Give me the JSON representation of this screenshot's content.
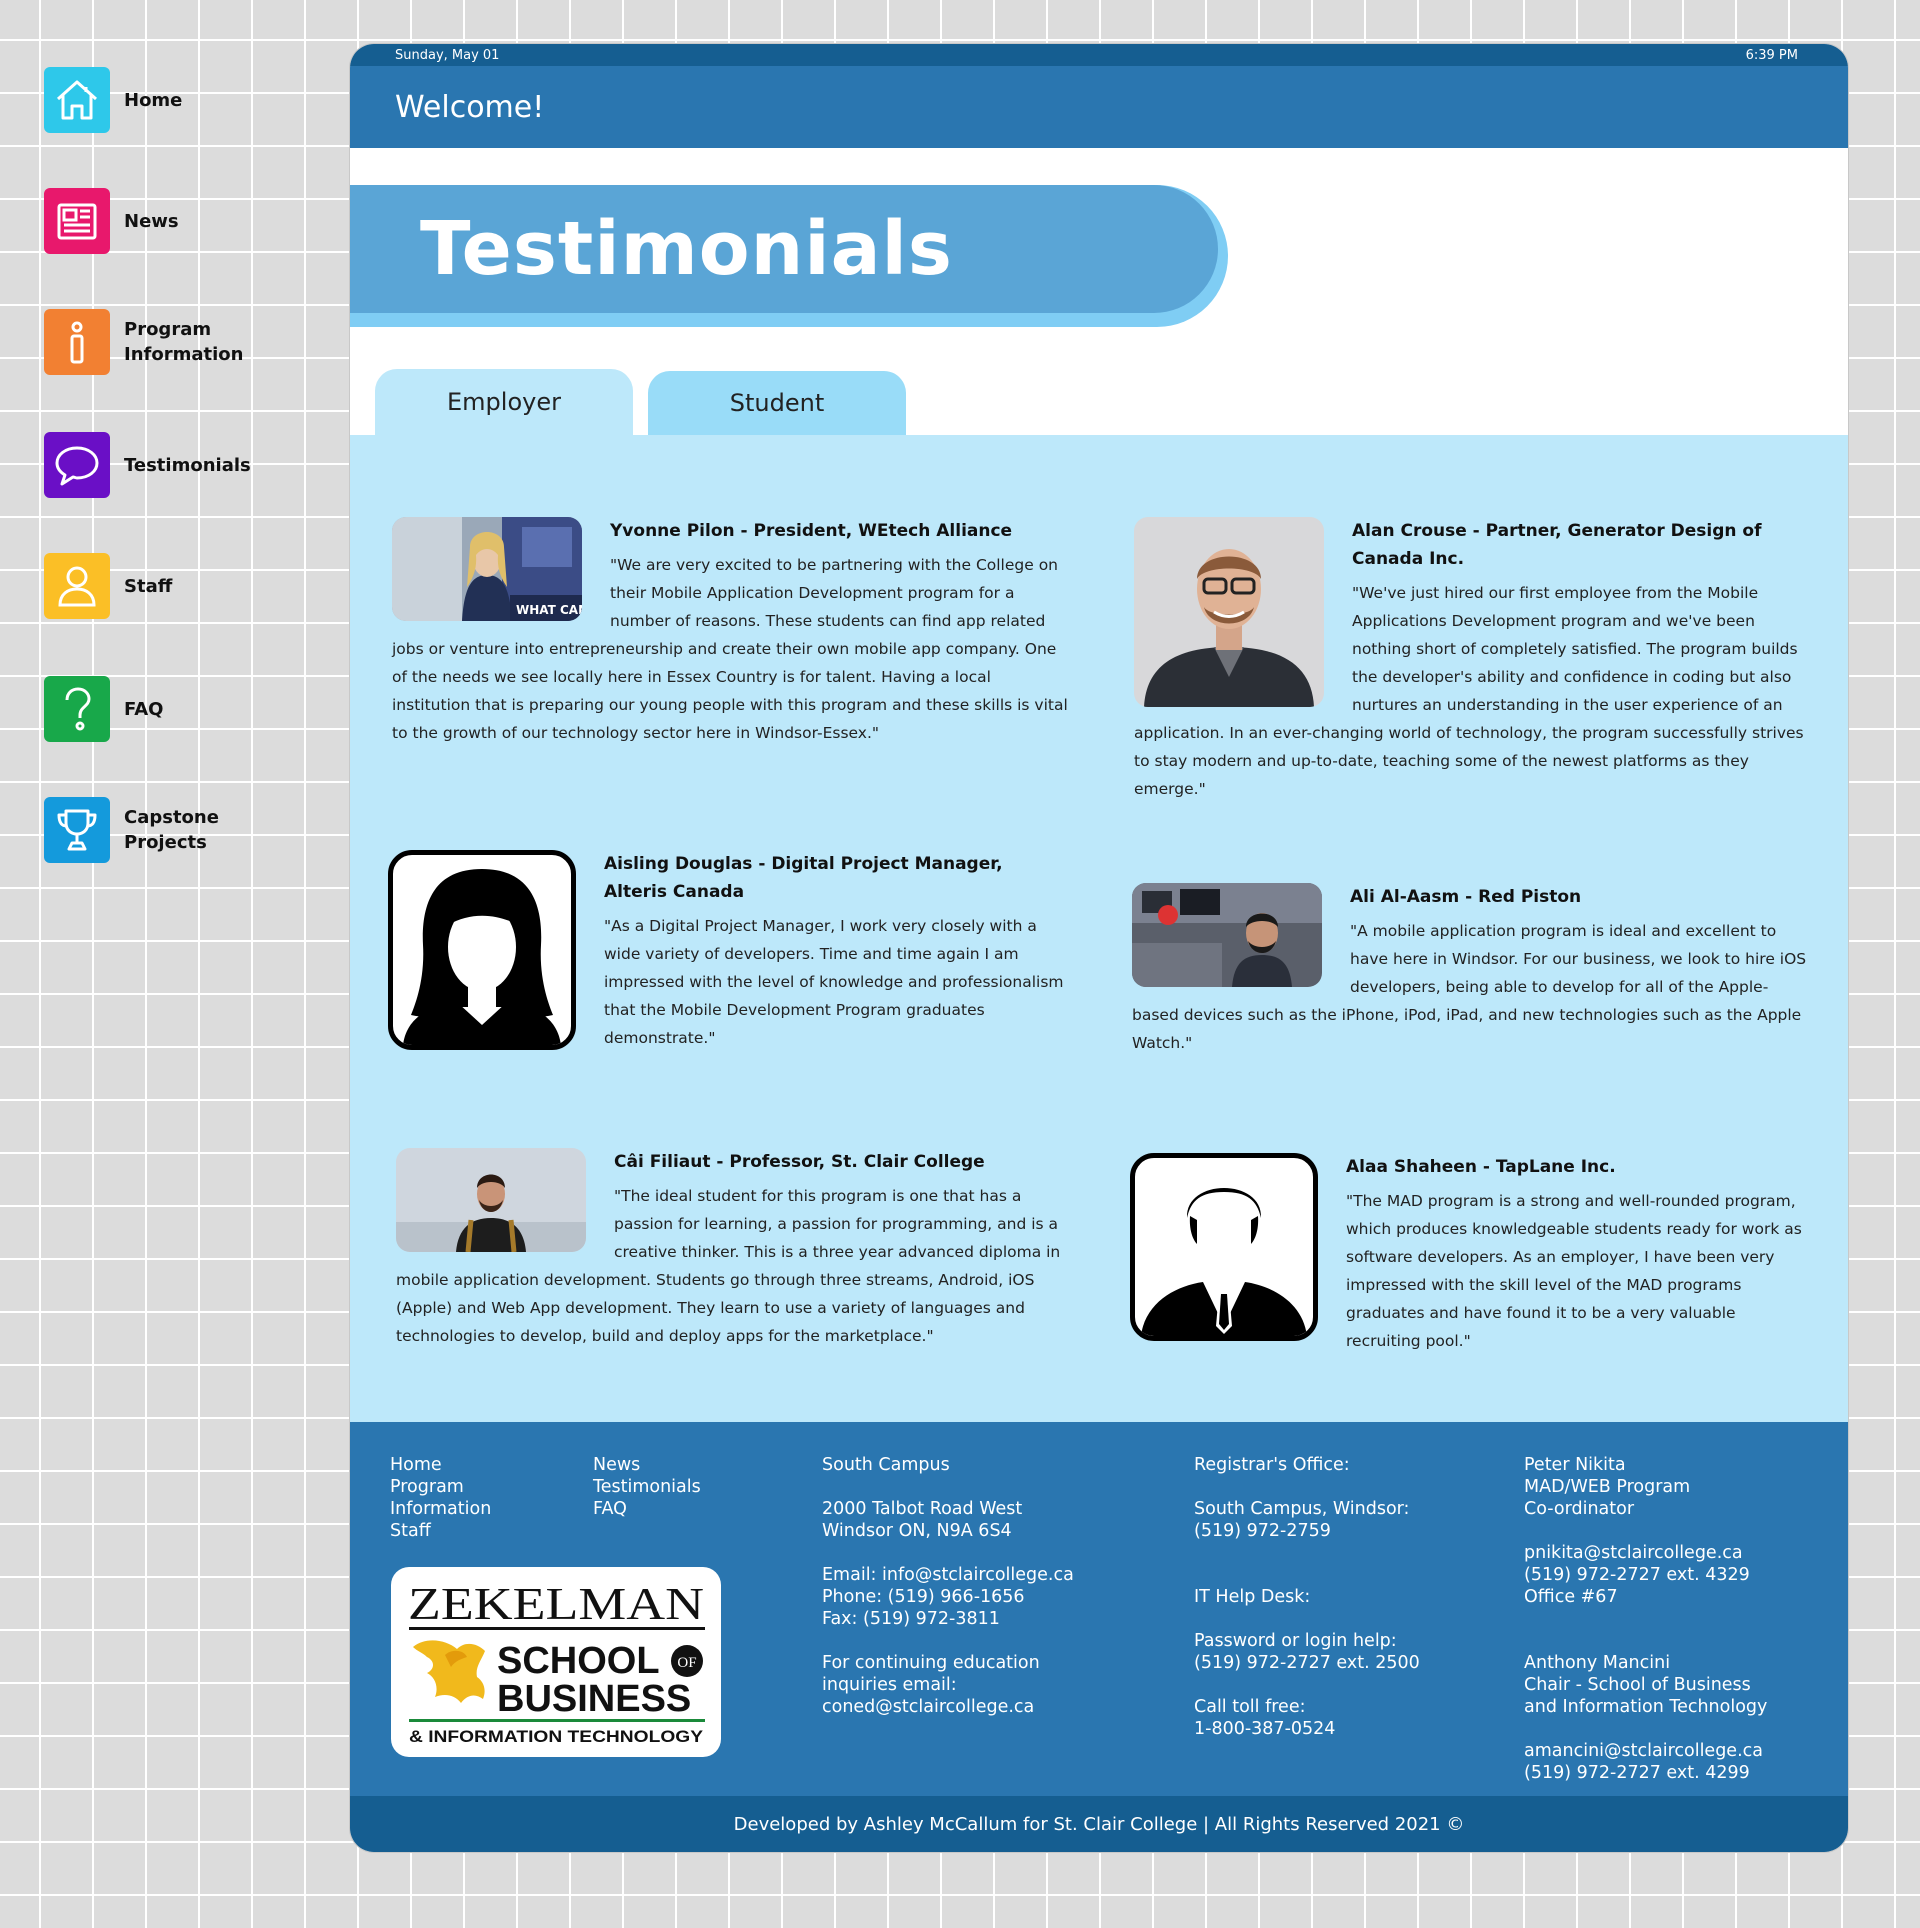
{
  "nav": [
    {
      "label_lines": [
        "Home"
      ],
      "icon": "home-icon",
      "color": "#2ec8ea"
    },
    {
      "label_lines": [
        "News"
      ],
      "icon": "news-icon",
      "color": "#e8186c"
    },
    {
      "label_lines": [
        "Program",
        "Information"
      ],
      "icon": "info-icon",
      "color": "#f28032"
    },
    {
      "label_lines": [
        "Testimonials"
      ],
      "icon": "chat-bubble-icon",
      "color": "#6a0fc6"
    },
    {
      "label_lines": [
        "Staff"
      ],
      "icon": "person-icon",
      "color": "#fbbf26"
    },
    {
      "label_lines": [
        "FAQ"
      ],
      "icon": "question-icon",
      "color": "#18a84a"
    },
    {
      "label_lines": [
        "Capstone",
        "Projects"
      ],
      "icon": "trophy-icon",
      "color": "#149adc"
    }
  ],
  "header": {
    "date": "Sunday, May 01",
    "time": "6:39 PM",
    "welcome": "Welcome!"
  },
  "page_title": "Testimonials",
  "tabs": [
    {
      "label": "Employer",
      "active": true
    },
    {
      "label": "Student",
      "active": false
    }
  ],
  "testimonials": [
    {
      "name": "Yvonne Pilon - President, WEtech Alliance",
      "quote": "\"We are very excited to be partnering with the College on their Mobile Application Development program for a number of reasons. These students can find app related jobs or venture into entrepreneurship and create their own mobile app company. One of the needs we see locally here in Essex Country is for talent. Having a local institution that is preparing our young people with this program and these skills is vital to the growth of our technology sector here in Windsor-Essex.\"",
      "photo_text": "WHAT CAN"
    },
    {
      "name": "Alan Crouse - Partner, Generator Design of Canada Inc.",
      "quote": "\"We've just hired our first employee from the Mobile Applications Development program and we've been nothing short of completely satisfied. The program builds the developer's ability and confidence in coding but also nurtures an understanding in the user experience of an application. In an ever-changing world of technology, the program successfully strives to stay modern and up-to-date, teaching some of the newest platforms as they emerge.\""
    },
    {
      "name": "Aisling Douglas - Digital Project Manager, Alteris Canada",
      "quote": "\"As a Digital Project Manager, I work very closely with a wide variety of developers. Time and time again I am impressed with the level of knowledge and professionalism that the Mobile Development Program graduates demonstrate.\""
    },
    {
      "name": "Ali Al-Aasm - Red Piston",
      "quote": "\"A mobile application program is ideal and excellent to have here in Windsor. For our business, we look to hire iOS developers, being able to develop for all of the Apple-based devices such as the iPhone, iPod, iPad, and new technologies such as the Apple Watch.\""
    },
    {
      "name": "Câi Filiaut - Professor, St. Clair College",
      "quote": "\"The ideal student for this program is one that has a passion for learning, a passion for programming, and is a creative thinker. This is a three year advanced diploma in mobile application development. Students go through three streams, Android, iOS (Apple) and Web App development. They learn to use a variety of languages and technologies to develop, build and deploy apps for the marketplace.\""
    },
    {
      "name": "Alaa Shaheen - TapLane Inc.",
      "quote": "\"The MAD program is a strong and well-rounded program, which produces knowledgeable students ready for work as software developers. As an employer, I have been very impressed with the skill level of the MAD programs graduates and have found it to be a very valuable recruiting pool.\""
    }
  ],
  "footer": {
    "links_col1": [
      "Home",
      "Program",
      "Information",
      "Staff"
    ],
    "links_col2": [
      "News",
      "Testimonials",
      "FAQ"
    ],
    "campus": {
      "title": "South Campus",
      "address1": "2000 Talbot Road West",
      "address2": "Windsor ON, N9A 6S4",
      "email": "Email: info@stclaircollege.ca",
      "phone": "Phone: (519) 966-1656",
      "fax": "Fax: (519) 972-3811",
      "coned1": "For continuing education",
      "coned2": "inquiries email:",
      "coned3": "coned@stclaircollege.ca"
    },
    "registrar": {
      "title": "Registrar's Office:",
      "campus": "South Campus, Windsor:",
      "phone": "(519) 972-2759",
      "it": "IT Help Desk:",
      "pw": "Password or login help:",
      "pw_phone": "(519) 972-2727 ext. 2500",
      "toll": "Call toll free:",
      "toll_phone": "1-800-387-0524"
    },
    "contacts": {
      "p1_name": "Peter Nikita",
      "p1_role1": "MAD/WEB Program",
      "p1_role2": "Co-ordinator",
      "p1_email": "pnikita@stclaircollege.ca",
      "p1_phone": "(519) 972-2727 ext. 4329",
      "p1_office": "Office #67",
      "p2_name": "Anthony Mancini",
      "p2_role1": "Chair - School of Business",
      "p2_role2": "and Information Technology",
      "p2_email": "amancini@stclaircollege.ca",
      "p2_phone": "(519) 972-2727 ext. 4299"
    },
    "logo": {
      "line1": "ZEKELMAN",
      "line2": "SCHOOL",
      "of": "OF",
      "line3": "BUSINESS",
      "line4": "& INFORMATION TECHNOLOGY"
    },
    "copyright": "Developed by Ashley McCallum for St. Clair College  |  All Rights Reserved 2021 ©"
  }
}
